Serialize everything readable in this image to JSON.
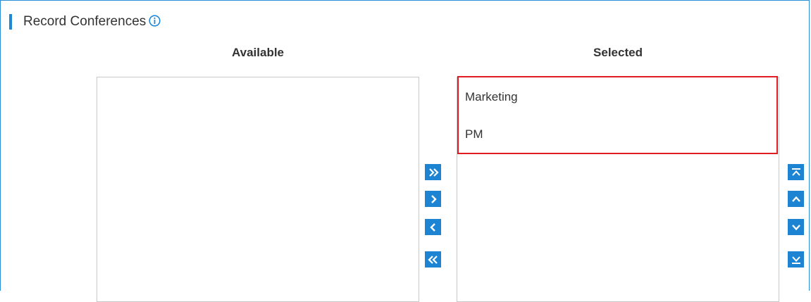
{
  "section": {
    "title": "Record Conferences",
    "info_icon": "info-circle-icon",
    "accent_color": "#1e88d6"
  },
  "available": {
    "title": "Available",
    "items": []
  },
  "selected": {
    "title": "Selected",
    "items": [
      "Marketing",
      "PM"
    ],
    "highlight_color": "#e31b23"
  },
  "transfer_buttons": [
    {
      "icon": "double-chevron-right-icon",
      "action": "add-all"
    },
    {
      "icon": "chevron-right-icon",
      "action": "add"
    },
    {
      "icon": "chevron-left-icon",
      "action": "remove"
    },
    {
      "icon": "double-chevron-left-icon",
      "action": "remove-all"
    }
  ],
  "order_buttons": [
    {
      "icon": "move-top-icon",
      "action": "move-to-top"
    },
    {
      "icon": "chevron-up-icon",
      "action": "move-up"
    },
    {
      "icon": "chevron-down-icon",
      "action": "move-down"
    },
    {
      "icon": "move-bottom-icon",
      "action": "move-to-bottom"
    }
  ],
  "button_color": "#1c84d3"
}
